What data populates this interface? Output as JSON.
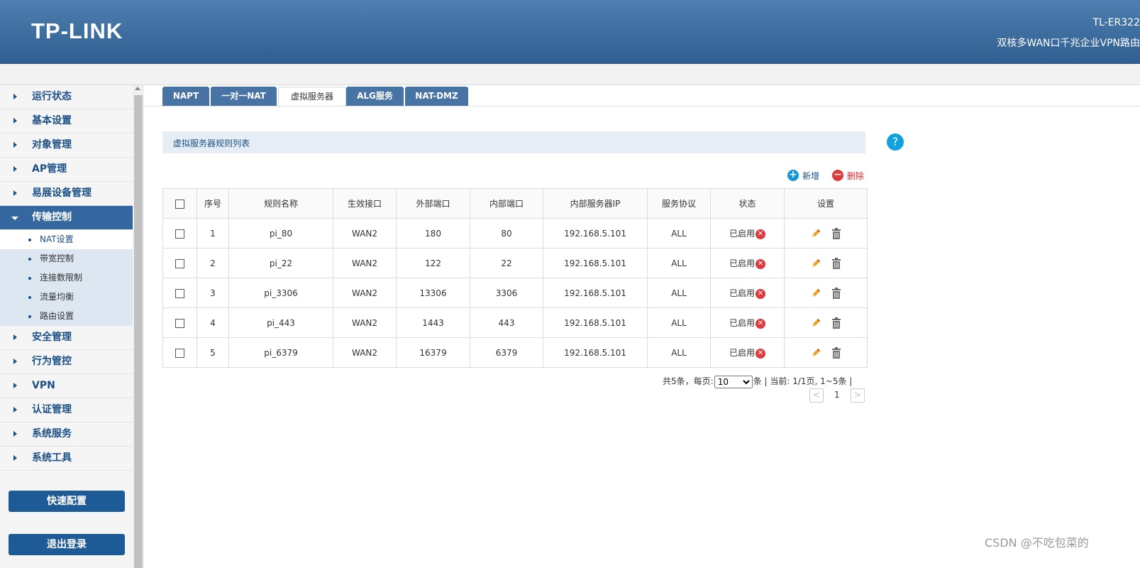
{
  "header": {
    "logo": "TP-LINK",
    "model": "TL-ER322",
    "description": "双核多WAN口千兆企业VPN路由"
  },
  "sidebar": {
    "items_top": [
      {
        "label": "运行状态"
      },
      {
        "label": "基本设置"
      },
      {
        "label": "对象管理"
      },
      {
        "label": "AP管理"
      },
      {
        "label": "易展设备管理"
      },
      {
        "label": "传输控制",
        "active": true
      }
    ],
    "subitems": [
      {
        "label": "NAT设置",
        "selected": true
      },
      {
        "label": "带宽控制"
      },
      {
        "label": "连接数限制"
      },
      {
        "label": "流量均衡"
      },
      {
        "label": "路由设置"
      }
    ],
    "items_bottom": [
      {
        "label": "安全管理"
      },
      {
        "label": "行为管控"
      },
      {
        "label": "VPN"
      },
      {
        "label": "认证管理"
      },
      {
        "label": "系统服务"
      },
      {
        "label": "系统工具"
      }
    ],
    "quick_config": "快速配置",
    "logout": "退出登录"
  },
  "tabs": [
    {
      "label": "NAPT"
    },
    {
      "label": "一对一NAT"
    },
    {
      "label": "虚拟服务器",
      "active": true
    },
    {
      "label": "ALG服务"
    },
    {
      "label": "NAT-DMZ"
    }
  ],
  "panel": {
    "title": "虚拟服务器规则列表",
    "help": "?",
    "add": "新增",
    "delete": "删除"
  },
  "table": {
    "headers": [
      "序号",
      "规则名称",
      "生效接口",
      "外部端口",
      "内部端口",
      "内部服务器IP",
      "服务协议",
      "状态",
      "设置"
    ],
    "rows": [
      {
        "index": "1",
        "name": "pi_80",
        "iface": "WAN2",
        "ext": "180",
        "int": "80",
        "ip": "192.168.5.101",
        "proto": "ALL",
        "status": "已启用"
      },
      {
        "index": "2",
        "name": "pi_22",
        "iface": "WAN2",
        "ext": "122",
        "int": "22",
        "ip": "192.168.5.101",
        "proto": "ALL",
        "status": "已启用"
      },
      {
        "index": "3",
        "name": "pi_3306",
        "iface": "WAN2",
        "ext": "13306",
        "int": "3306",
        "ip": "192.168.5.101",
        "proto": "ALL",
        "status": "已启用"
      },
      {
        "index": "4",
        "name": "pi_443",
        "iface": "WAN2",
        "ext": "1443",
        "int": "443",
        "ip": "192.168.5.101",
        "proto": "ALL",
        "status": "已启用"
      },
      {
        "index": "5",
        "name": "pi_6379",
        "iface": "WAN2",
        "ext": "16379",
        "int": "6379",
        "ip": "192.168.5.101",
        "proto": "ALL",
        "status": "已启用"
      }
    ]
  },
  "pager": {
    "summary_prefix": "共5条，每页:",
    "page_size": "10",
    "summary_suffix": "条 | 当前: 1/1页, 1~5条 |",
    "current_page": "1",
    "prev": "<",
    "next": ">"
  },
  "watermark": "CSDN @不吃包菜的"
}
